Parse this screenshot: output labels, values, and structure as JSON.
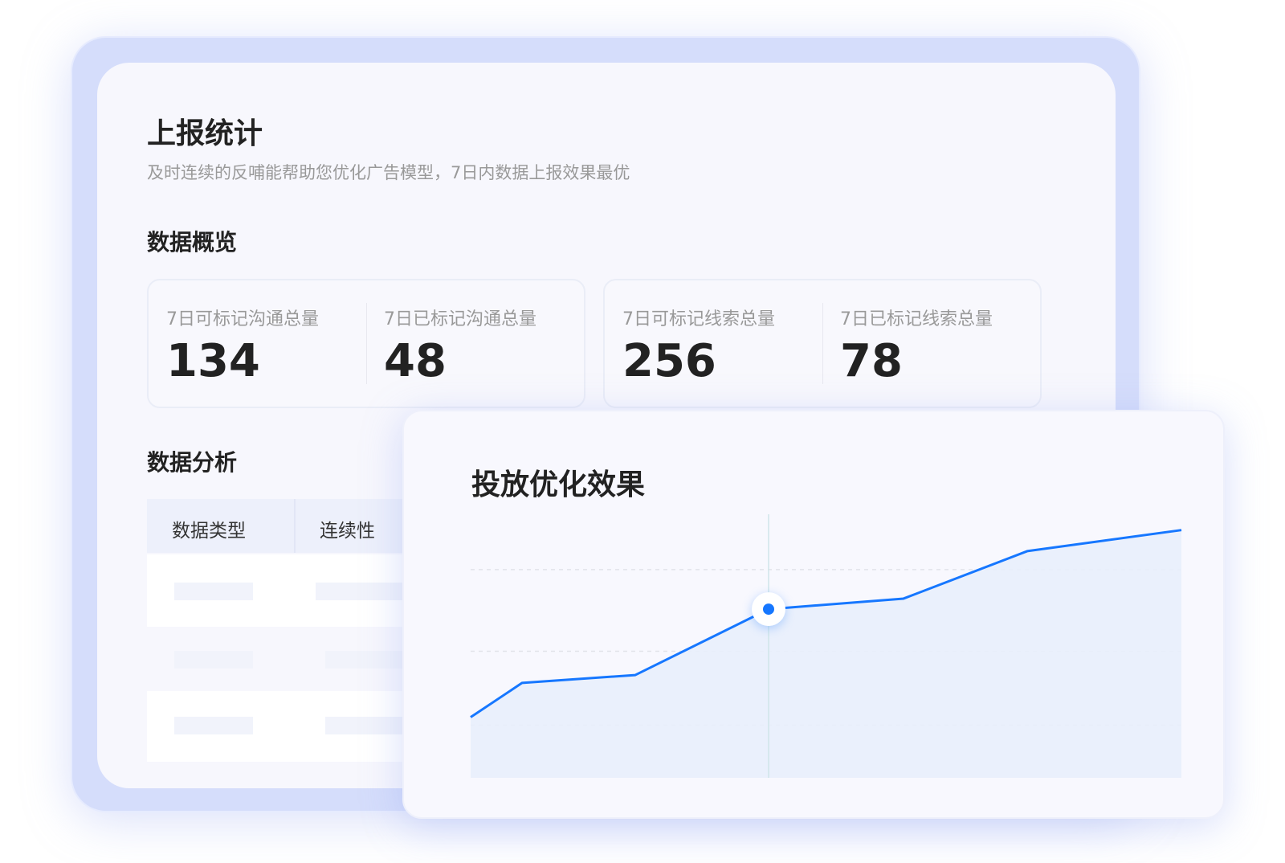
{
  "header": {
    "title": "上报统计",
    "subtitle": "及时连续的反哺能帮助您优化广告模型，7日内数据上报效果最优"
  },
  "overview": {
    "title": "数据概览",
    "cards": [
      {
        "items": [
          {
            "label": "7日可标记沟通总量",
            "value": "134"
          },
          {
            "label": "7日已标记沟通总量",
            "value": "48"
          }
        ]
      },
      {
        "items": [
          {
            "label": "7日可标记线索总量",
            "value": "256"
          },
          {
            "label": "7日已标记线索总量",
            "value": "78"
          }
        ]
      }
    ]
  },
  "analysis": {
    "title": "数据分析",
    "columns": [
      "数据类型",
      "连续性"
    ]
  },
  "colors": {
    "accent": "#1677ff",
    "frame": "#d5ddfb"
  },
  "chart_data": {
    "type": "area",
    "title": "投放优化效果",
    "x": [
      1,
      2,
      3,
      4,
      5,
      6,
      7
    ],
    "values": [
      23,
      36,
      39,
      64,
      68,
      86,
      94
    ],
    "ylim": [
      0,
      100
    ],
    "gridlines": [
      20,
      48,
      79
    ],
    "highlight_index": 3,
    "xlabel": "",
    "ylabel": ""
  }
}
